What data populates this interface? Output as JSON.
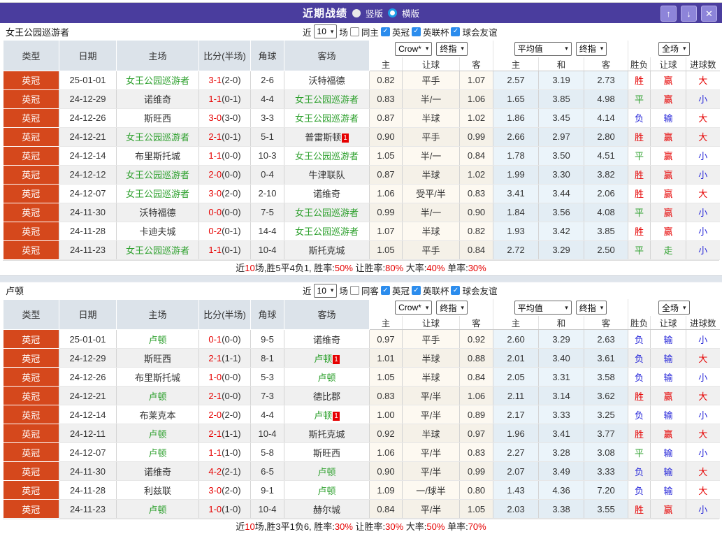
{
  "titlebar": {
    "title": "近期战绩",
    "view_vertical": "竖版",
    "view_horizontal": "横版"
  },
  "icons": {
    "up": "↑",
    "down": "↓",
    "close": "✕",
    "check": "✓",
    "chevron": "▾"
  },
  "colors": {
    "accent_purple": "#4a3d9e",
    "league_badge": "#d5481c",
    "team_green": "#2da02d",
    "score_red": "#e60000",
    "lose_blue": "#2626d9",
    "header_bg": "#dce3ea"
  },
  "filters": {
    "near_label": "近",
    "count": "10",
    "matches_label": "场",
    "leagues": [
      "英冠",
      "英联杯",
      "球会友谊"
    ]
  },
  "dropdowns": {
    "bookmaker": "Crow*",
    "final": "终指",
    "average": "平均值",
    "final2": "终指",
    "scope": "全场"
  },
  "columns": {
    "type": "类型",
    "date": "日期",
    "home": "主场",
    "score": "比分(半场)",
    "corner": "角球",
    "away": "客场",
    "odds_home": "主",
    "odds_handicap": "让球",
    "odds_away": "客",
    "avg_home": "主",
    "avg_draw": "和",
    "avg_away": "客",
    "result_wl": "胜负",
    "result_handicap": "让球",
    "result_goals": "进球数"
  },
  "sections": [
    {
      "team": "女王公园巡游者",
      "same_label": "同主",
      "rows": [
        {
          "lg": "英冠",
          "date": "25-01-01",
          "home": {
            "n": "女王公园巡游者",
            "t": 1
          },
          "score": "3-1",
          "half": "(2-0)",
          "corner": "2-6",
          "away": {
            "n": "沃特福德"
          },
          "odds": [
            "0.82",
            "平手",
            "1.07"
          ],
          "avg": [
            "2.57",
            "3.19",
            "2.73"
          ],
          "res": [
            [
              "胜",
              "r"
            ],
            [
              "赢",
              "r"
            ],
            [
              "大",
              "r"
            ]
          ]
        },
        {
          "lg": "英冠",
          "date": "24-12-29",
          "home": {
            "n": "诺维奇"
          },
          "score": "1-1",
          "half": "(0-1)",
          "corner": "4-4",
          "away": {
            "n": "女王公园巡游者",
            "t": 1
          },
          "odds": [
            "0.83",
            "半/一",
            "1.06"
          ],
          "avg": [
            "1.65",
            "3.85",
            "4.98"
          ],
          "res": [
            [
              "平",
              "g"
            ],
            [
              "赢",
              "r"
            ],
            [
              "小",
              "b"
            ]
          ]
        },
        {
          "lg": "英冠",
          "date": "24-12-26",
          "home": {
            "n": "斯旺西"
          },
          "score": "3-0",
          "half": "(3-0)",
          "corner": "3-3",
          "away": {
            "n": "女王公园巡游者",
            "t": 1
          },
          "odds": [
            "0.87",
            "半球",
            "1.02"
          ],
          "avg": [
            "1.86",
            "3.45",
            "4.14"
          ],
          "res": [
            [
              "负",
              "b"
            ],
            [
              "输",
              "b"
            ],
            [
              "大",
              "r"
            ]
          ]
        },
        {
          "lg": "英冠",
          "date": "24-12-21",
          "home": {
            "n": "女王公园巡游者",
            "t": 1
          },
          "score": "2-1",
          "half": "(0-1)",
          "corner": "5-1",
          "away": {
            "n": "普雷斯顿",
            "b": "1"
          },
          "odds": [
            "0.90",
            "平手",
            "0.99"
          ],
          "avg": [
            "2.66",
            "2.97",
            "2.80"
          ],
          "res": [
            [
              "胜",
              "r"
            ],
            [
              "赢",
              "r"
            ],
            [
              "大",
              "r"
            ]
          ]
        },
        {
          "lg": "英冠",
          "date": "24-12-14",
          "home": {
            "n": "布里斯托城"
          },
          "score": "1-1",
          "half": "(0-0)",
          "corner": "10-3",
          "away": {
            "n": "女王公园巡游者",
            "t": 1
          },
          "odds": [
            "1.05",
            "半/一",
            "0.84"
          ],
          "avg": [
            "1.78",
            "3.50",
            "4.51"
          ],
          "res": [
            [
              "平",
              "g"
            ],
            [
              "赢",
              "r"
            ],
            [
              "小",
              "b"
            ]
          ]
        },
        {
          "lg": "英冠",
          "date": "24-12-12",
          "home": {
            "n": "女王公园巡游者",
            "t": 1
          },
          "score": "2-0",
          "half": "(0-0)",
          "corner": "0-4",
          "away": {
            "n": "牛津联队"
          },
          "odds": [
            "0.87",
            "半球",
            "1.02"
          ],
          "avg": [
            "1.99",
            "3.30",
            "3.82"
          ],
          "res": [
            [
              "胜",
              "r"
            ],
            [
              "赢",
              "r"
            ],
            [
              "小",
              "b"
            ]
          ]
        },
        {
          "lg": "英冠",
          "date": "24-12-07",
          "home": {
            "n": "女王公园巡游者",
            "t": 1
          },
          "score": "3-0",
          "half": "(2-0)",
          "corner": "2-10",
          "away": {
            "n": "诺维奇"
          },
          "odds": [
            "1.06",
            "受平/半",
            "0.83"
          ],
          "avg": [
            "3.41",
            "3.44",
            "2.06"
          ],
          "res": [
            [
              "胜",
              "r"
            ],
            [
              "赢",
              "r"
            ],
            [
              "大",
              "r"
            ]
          ]
        },
        {
          "lg": "英冠",
          "date": "24-11-30",
          "home": {
            "n": "沃特福德"
          },
          "score": "0-0",
          "half": "(0-0)",
          "corner": "7-5",
          "away": {
            "n": "女王公园巡游者",
            "t": 1
          },
          "odds": [
            "0.99",
            "半/一",
            "0.90"
          ],
          "avg": [
            "1.84",
            "3.56",
            "4.08"
          ],
          "res": [
            [
              "平",
              "g"
            ],
            [
              "赢",
              "r"
            ],
            [
              "小",
              "b"
            ]
          ]
        },
        {
          "lg": "英冠",
          "date": "24-11-28",
          "home": {
            "n": "卡迪夫城"
          },
          "score": "0-2",
          "half": "(0-1)",
          "corner": "14-4",
          "away": {
            "n": "女王公园巡游者",
            "t": 1
          },
          "odds": [
            "1.07",
            "半球",
            "0.82"
          ],
          "avg": [
            "1.93",
            "3.42",
            "3.85"
          ],
          "res": [
            [
              "胜",
              "r"
            ],
            [
              "赢",
              "r"
            ],
            [
              "小",
              "b"
            ]
          ]
        },
        {
          "lg": "英冠",
          "date": "24-11-23",
          "home": {
            "n": "女王公园巡游者",
            "t": 1
          },
          "score": "1-1",
          "half": "(0-1)",
          "corner": "10-4",
          "away": {
            "n": "斯托克城"
          },
          "odds": [
            "1.05",
            "平手",
            "0.84"
          ],
          "avg": [
            "2.72",
            "3.29",
            "2.50"
          ],
          "res": [
            [
              "平",
              "g"
            ],
            [
              "走",
              "g"
            ],
            [
              "小",
              "b"
            ]
          ]
        }
      ],
      "summary": [
        {
          "t": "近"
        },
        {
          "t": "10",
          "red": true
        },
        {
          "t": "场,胜5平4负1, 胜率:"
        },
        {
          "t": "50%",
          "red": true
        },
        {
          "t": " 让胜率:"
        },
        {
          "t": "80%",
          "red": true
        },
        {
          "t": " 大率:"
        },
        {
          "t": "40%",
          "red": true
        },
        {
          "t": " 单率:"
        },
        {
          "t": "30%",
          "red": true
        }
      ]
    },
    {
      "team": "卢顿",
      "same_label": "同客",
      "rows": [
        {
          "lg": "英冠",
          "date": "25-01-01",
          "home": {
            "n": "卢顿",
            "t": 1
          },
          "score": "0-1",
          "half": "(0-0)",
          "corner": "9-5",
          "away": {
            "n": "诺维奇"
          },
          "odds": [
            "0.97",
            "平手",
            "0.92"
          ],
          "avg": [
            "2.60",
            "3.29",
            "2.63"
          ],
          "res": [
            [
              "负",
              "b"
            ],
            [
              "输",
              "b"
            ],
            [
              "小",
              "b"
            ]
          ]
        },
        {
          "lg": "英冠",
          "date": "24-12-29",
          "home": {
            "n": "斯旺西"
          },
          "score": "2-1",
          "half": "(1-1)",
          "corner": "8-1",
          "away": {
            "n": "卢顿",
            "t": 1,
            "b": "1"
          },
          "odds": [
            "1.01",
            "半球",
            "0.88"
          ],
          "avg": [
            "2.01",
            "3.40",
            "3.61"
          ],
          "res": [
            [
              "负",
              "b"
            ],
            [
              "输",
              "b"
            ],
            [
              "大",
              "r"
            ]
          ]
        },
        {
          "lg": "英冠",
          "date": "24-12-26",
          "home": {
            "n": "布里斯托城"
          },
          "score": "1-0",
          "half": "(0-0)",
          "corner": "5-3",
          "away": {
            "n": "卢顿",
            "t": 1
          },
          "odds": [
            "1.05",
            "半球",
            "0.84"
          ],
          "avg": [
            "2.05",
            "3.31",
            "3.58"
          ],
          "res": [
            [
              "负",
              "b"
            ],
            [
              "输",
              "b"
            ],
            [
              "小",
              "b"
            ]
          ]
        },
        {
          "lg": "英冠",
          "date": "24-12-21",
          "home": {
            "n": "卢顿",
            "t": 1
          },
          "score": "2-1",
          "half": "(0-0)",
          "corner": "7-3",
          "away": {
            "n": "德比郡"
          },
          "odds": [
            "0.83",
            "平/半",
            "1.06"
          ],
          "avg": [
            "2.11",
            "3.14",
            "3.62"
          ],
          "res": [
            [
              "胜",
              "r"
            ],
            [
              "赢",
              "r"
            ],
            [
              "大",
              "r"
            ]
          ]
        },
        {
          "lg": "英冠",
          "date": "24-12-14",
          "home": {
            "n": "布莱克本"
          },
          "score": "2-0",
          "half": "(2-0)",
          "corner": "4-4",
          "away": {
            "n": "卢顿",
            "t": 1,
            "b": "1"
          },
          "odds": [
            "1.00",
            "平/半",
            "0.89"
          ],
          "avg": [
            "2.17",
            "3.33",
            "3.25"
          ],
          "res": [
            [
              "负",
              "b"
            ],
            [
              "输",
              "b"
            ],
            [
              "小",
              "b"
            ]
          ]
        },
        {
          "lg": "英冠",
          "date": "24-12-11",
          "home": {
            "n": "卢顿",
            "t": 1
          },
          "score": "2-1",
          "half": "(1-1)",
          "corner": "10-4",
          "away": {
            "n": "斯托克城"
          },
          "odds": [
            "0.92",
            "半球",
            "0.97"
          ],
          "avg": [
            "1.96",
            "3.41",
            "3.77"
          ],
          "res": [
            [
              "胜",
              "r"
            ],
            [
              "赢",
              "r"
            ],
            [
              "大",
              "r"
            ]
          ]
        },
        {
          "lg": "英冠",
          "date": "24-12-07",
          "home": {
            "n": "卢顿",
            "t": 1
          },
          "score": "1-1",
          "half": "(1-0)",
          "corner": "5-8",
          "away": {
            "n": "斯旺西"
          },
          "odds": [
            "1.06",
            "平/半",
            "0.83"
          ],
          "avg": [
            "2.27",
            "3.28",
            "3.08"
          ],
          "res": [
            [
              "平",
              "g"
            ],
            [
              "输",
              "b"
            ],
            [
              "小",
              "b"
            ]
          ]
        },
        {
          "lg": "英冠",
          "date": "24-11-30",
          "home": {
            "n": "诺维奇"
          },
          "score": "4-2",
          "half": "(2-1)",
          "corner": "6-5",
          "away": {
            "n": "卢顿",
            "t": 1
          },
          "odds": [
            "0.90",
            "平/半",
            "0.99"
          ],
          "avg": [
            "2.07",
            "3.49",
            "3.33"
          ],
          "res": [
            [
              "负",
              "b"
            ],
            [
              "输",
              "b"
            ],
            [
              "大",
              "r"
            ]
          ]
        },
        {
          "lg": "英冠",
          "date": "24-11-28",
          "home": {
            "n": "利兹联"
          },
          "score": "3-0",
          "half": "(2-0)",
          "corner": "9-1",
          "away": {
            "n": "卢顿",
            "t": 1
          },
          "odds": [
            "1.09",
            "一/球半",
            "0.80"
          ],
          "avg": [
            "1.43",
            "4.36",
            "7.20"
          ],
          "res": [
            [
              "负",
              "b"
            ],
            [
              "输",
              "b"
            ],
            [
              "大",
              "r"
            ]
          ]
        },
        {
          "lg": "英冠",
          "date": "24-11-23",
          "home": {
            "n": "卢顿",
            "t": 1
          },
          "score": "1-0",
          "half": "(1-0)",
          "corner": "10-4",
          "away": {
            "n": "赫尔城"
          },
          "odds": [
            "0.84",
            "平/半",
            "1.05"
          ],
          "avg": [
            "2.03",
            "3.38",
            "3.55"
          ],
          "res": [
            [
              "胜",
              "r"
            ],
            [
              "赢",
              "r"
            ],
            [
              "小",
              "b"
            ]
          ]
        }
      ],
      "summary": [
        {
          "t": "近"
        },
        {
          "t": "10",
          "red": true
        },
        {
          "t": "场,胜3平1负6, 胜率:"
        },
        {
          "t": "30%",
          "red": true
        },
        {
          "t": " 让胜率:"
        },
        {
          "t": "30%",
          "red": true
        },
        {
          "t": " 大率:"
        },
        {
          "t": "50%",
          "red": true
        },
        {
          "t": " 单率:"
        },
        {
          "t": "70%",
          "red": true
        }
      ]
    }
  ]
}
